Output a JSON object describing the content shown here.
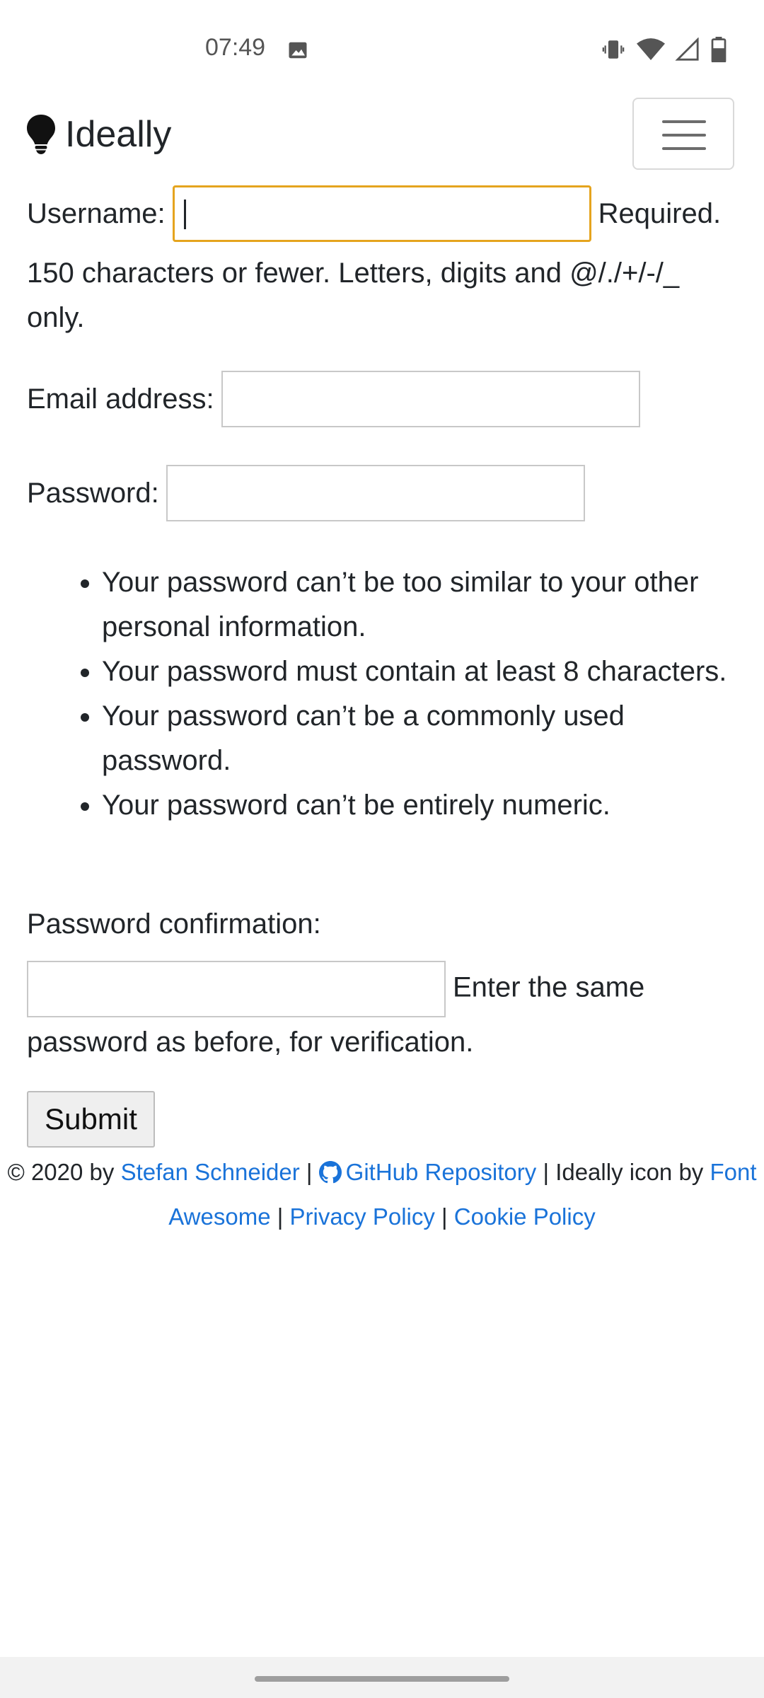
{
  "status_bar": {
    "time": "07:49",
    "icons": [
      "image-icon",
      "vibrate-icon",
      "wifi-icon",
      "signal-icon",
      "battery-icon"
    ]
  },
  "navbar": {
    "brand": "Ideally",
    "brand_icon": "lightbulb-icon",
    "menu_icon": "hamburger-menu-icon"
  },
  "form": {
    "username": {
      "label": "Username:",
      "value": "",
      "required_text": "Required.",
      "help": "150 characters or fewer. Letters, digits and @/./+/-/_ only."
    },
    "email": {
      "label": "Email address:",
      "value": ""
    },
    "password": {
      "label": "Password:",
      "value": "",
      "help_items": [
        "Your password can’t be too similar to your other personal information.",
        "Your password must contain at least 8 characters.",
        "Your password can’t be a commonly used password.",
        "Your password can’t be entirely numeric."
      ]
    },
    "password_confirmation": {
      "label": "Password confirmation:",
      "value": "",
      "help": "Enter the same password as before, for verification."
    },
    "submit_label": "Submit"
  },
  "footer": {
    "copyright": "© 2020 by",
    "author_link": "Stefan Schneider",
    "sep": "|",
    "github_link": "GitHub Repository",
    "icon_credit": "Ideally icon by",
    "font_awesome_link": "Font Awesome",
    "privacy_link": "Privacy Policy",
    "cookie_link": "Cookie Policy"
  },
  "colors": {
    "link": "#1a73d9",
    "focus_border": "#e5a41e",
    "text": "#212529"
  }
}
